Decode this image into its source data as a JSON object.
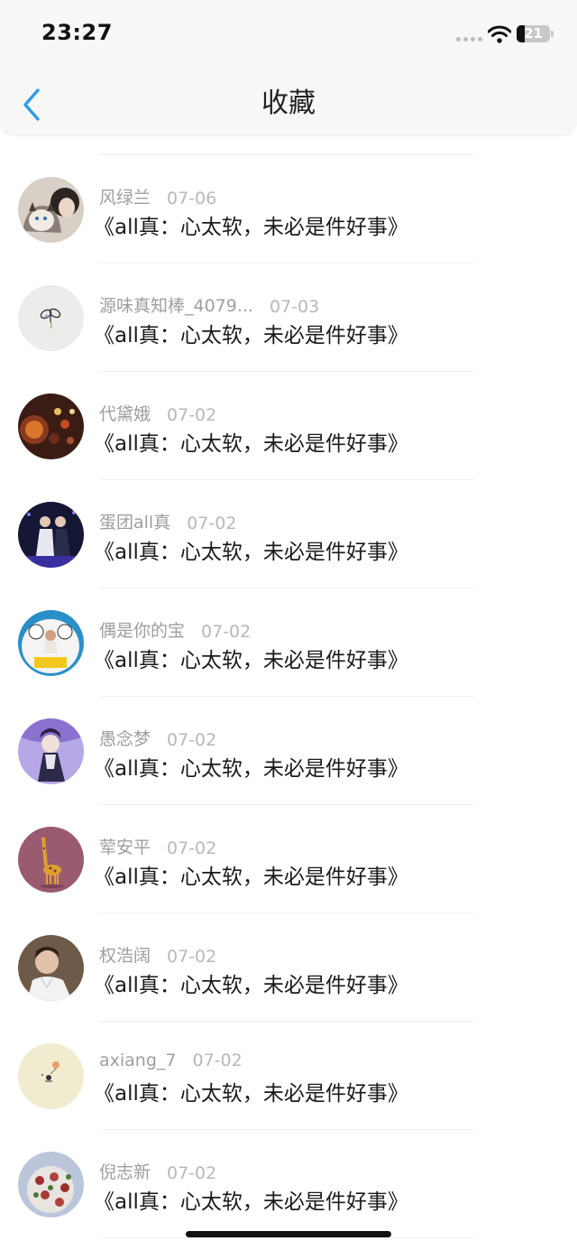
{
  "status_bar": {
    "time": "23:27",
    "battery_level": "21"
  },
  "header": {
    "title": "收藏",
    "back_icon": "chevron-left-icon",
    "accent_color": "#2f9be8"
  },
  "items": [
    {
      "name": "风绿兰",
      "date": "07-06",
      "content": "《all真：心太软，未必是件好事》"
    },
    {
      "name": "源味真知棒_4079...",
      "date": "07-03",
      "content": "《all真：心太软，未必是件好事》"
    },
    {
      "name": "代黛娥",
      "date": "07-02",
      "content": "《all真：心太软，未必是件好事》"
    },
    {
      "name": "蛋团all真",
      "date": "07-02",
      "content": "《all真：心太软，未必是件好事》"
    },
    {
      "name": "偶是你的宝",
      "date": "07-02",
      "content": "《all真：心太软，未必是件好事》"
    },
    {
      "name": "愚念梦",
      "date": "07-02",
      "content": "《all真：心太软，未必是件好事》"
    },
    {
      "name": "荤安平",
      "date": "07-02",
      "content": "《all真：心太软，未必是件好事》"
    },
    {
      "name": "权浩阔",
      "date": "07-02",
      "content": "《all真：心太软，未必是件好事》"
    },
    {
      "name": "axiang_7",
      "date": "07-02",
      "content": "《all真：心太软，未必是件好事》"
    },
    {
      "name": "倪志新",
      "date": "07-02",
      "content": "《all真：心太软，未必是件好事》"
    }
  ]
}
